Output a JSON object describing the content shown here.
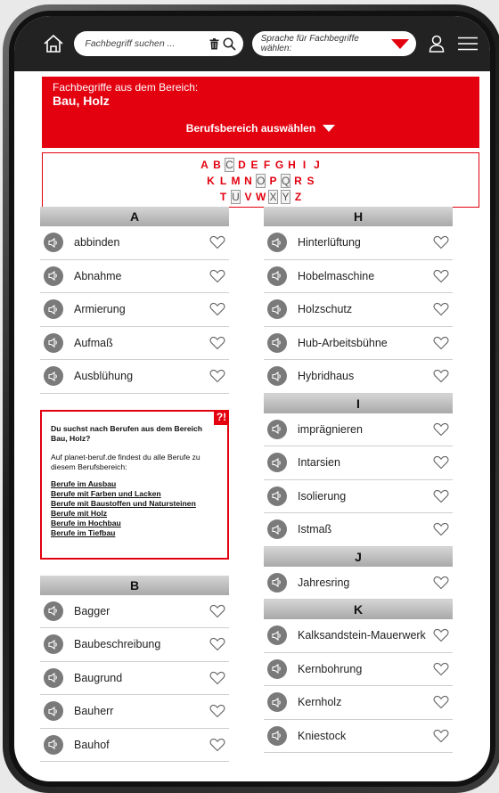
{
  "topbar": {
    "search_placeholder": "Fachbegriff suchen ...",
    "language_label": "Sprache für Fachbegriffe wählen:"
  },
  "header": {
    "subtitle": "Fachbegriffe aus dem Bereich:",
    "title": "Bau, Holz",
    "select_label": "Berufsbereich auswählen"
  },
  "alphabet": {
    "rows": [
      [
        "A",
        "B",
        "C",
        "D",
        "E",
        "F",
        "G",
        "H",
        "I",
        "J"
      ],
      [
        "K",
        "L",
        "M",
        "N",
        "O",
        "P",
        "Q",
        "R",
        "S"
      ],
      [
        "T",
        "U",
        "V",
        "W",
        "X",
        "Y",
        "Z"
      ]
    ],
    "disabled": [
      "C",
      "O",
      "Q",
      "U",
      "X",
      "Y"
    ]
  },
  "sections_left": [
    {
      "letter": "A",
      "items": [
        "abbinden",
        "Abnahme",
        "Armierung",
        "Aufmaß",
        "Ausblühung"
      ]
    }
  ],
  "infobox": {
    "badge": "?!",
    "question": "Du suchst nach Berufen aus dem Bereich Bau, Holz?",
    "text": "Auf planet-beruf.de findest du alle Berufe zu diesem Berufsbereich:",
    "links": [
      "Berufe im Ausbau",
      "Berufe mit Farben und Lacken",
      "Berufe mit Baustoffen und Natursteinen",
      "Berufe mit Holz",
      "Berufe im Hochbau",
      "Berufe im Tiefbau"
    ]
  },
  "section_b": {
    "letter": "B",
    "items": [
      "Bagger",
      "Baubeschreibung",
      "Baugrund",
      "Bauherr",
      "Bauhof"
    ]
  },
  "sections_right": [
    {
      "letter": "H",
      "items": [
        "Hinterlüftung",
        "Hobelmaschine",
        "Holzschutz",
        "Hub-Arbeitsbühne",
        "Hybridhaus"
      ]
    },
    {
      "letter": "I",
      "items": [
        "imprägnieren",
        "Intarsien",
        "Isolierung",
        "Istmaß"
      ]
    },
    {
      "letter": "J",
      "items": [
        "Jahresring"
      ]
    },
    {
      "letter": "K",
      "items": [
        "Kalksandstein-Mauerwerk",
        "Kernbohrung",
        "Kernholz",
        "Kniestock"
      ]
    }
  ],
  "colors": {
    "accent": "#e3000f",
    "topbar": "#222222"
  },
  "icons": {
    "home": "home-icon",
    "search": "search-icon",
    "trash": "trash-icon",
    "user": "user-icon",
    "menu": "menu-icon",
    "speaker": "speaker-icon",
    "heart": "heart-icon"
  }
}
